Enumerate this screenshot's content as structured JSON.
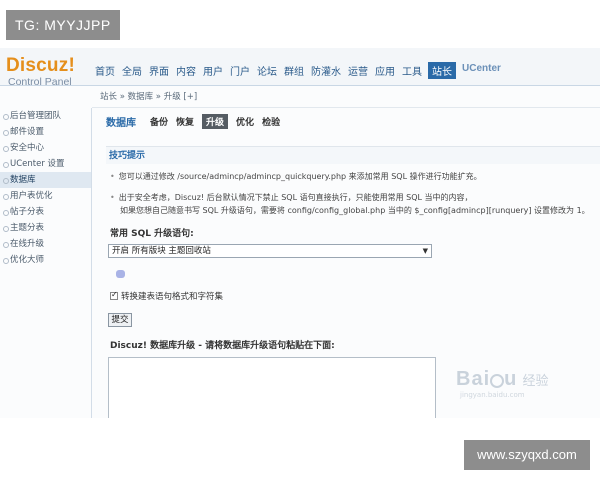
{
  "watermark": {
    "top_tag": "TG: MYYJJPP",
    "bottom_tag": "www.szyqxd.com",
    "baidu_main": "Bai",
    "baidu_main2": "u",
    "baidu_cn": "经验",
    "baidu_url": "jingyan.baidu.com"
  },
  "logo": {
    "main": "Discuz!",
    "sub": "Control Panel"
  },
  "topnav": {
    "items": [
      "首页",
      "全局",
      "界面",
      "内容",
      "用户",
      "门户",
      "论坛",
      "群组",
      "防灌水",
      "运营",
      "应用",
      "工具",
      "站长",
      "UCenter"
    ],
    "active_index": 12
  },
  "breadcrumb": "站长 » 数据库 » 升级  [+]",
  "sidebar": {
    "items": [
      "后台管理团队",
      "邮件设置",
      "安全中心",
      "UCenter 设置",
      "数据库",
      "用户表优化",
      "帖子分表",
      "主题分表",
      "在线升级",
      "优化大师"
    ],
    "active_index": 4
  },
  "subnav": {
    "title": "数据库",
    "tabs": [
      "备份",
      "恢复",
      "升级",
      "优化",
      "检验"
    ],
    "active_index": 2
  },
  "tips": {
    "header": "技巧提示",
    "line1": "您可以通过修改 /source/admincp/admincp_quickquery.php 来添加常用 SQL 操作进行功能扩充。",
    "line2": "出于安全考虑，Discuz! 后台默认情况下禁止 SQL 语句直接执行，只能使用常用 SQL 当中的内容，",
    "line3": "如果您想自己随意书写 SQL 升级语句，需要将 config/config_global.php 当中的 $_config[admincp][runquery] 设置修改为 1。"
  },
  "form": {
    "sql_label": "常用 SQL 升级语句:",
    "select_value": "开启 所有版块 主题回收站",
    "checkbox_label": "转换建表语句格式和字符集",
    "checkbox_checked": true,
    "submit_label": "提交",
    "upgrade_label": "Discuz! 数据库升级 - 请将数据库升级语句粘贴在下面:"
  }
}
